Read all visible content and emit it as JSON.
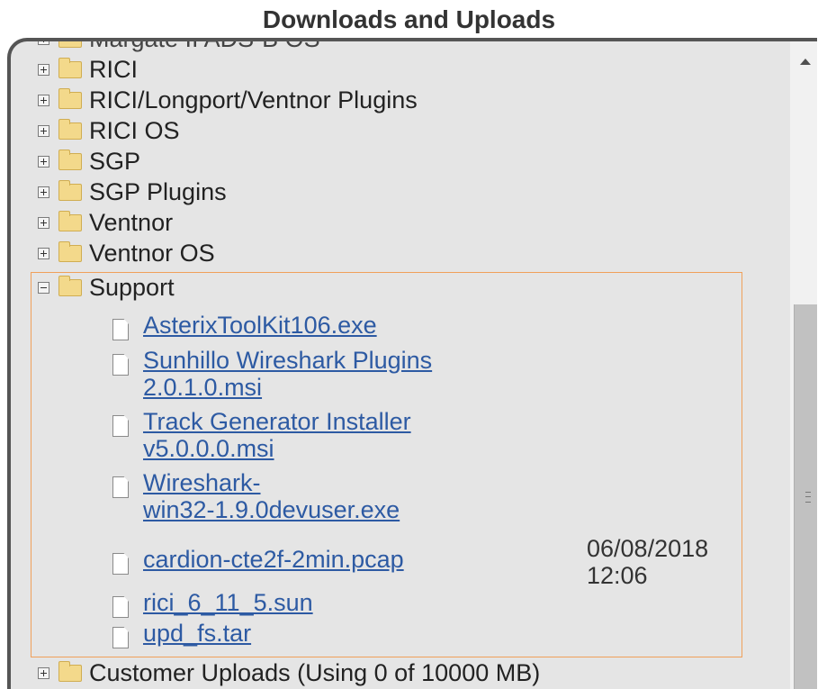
{
  "page_title": "Downloads and Uploads",
  "tree": {
    "partial_top_label": "Margate II ADS-B OS",
    "folders_top": [
      {
        "label": "RICI"
      },
      {
        "label": "RICI/Longport/Ventnor Plugins"
      },
      {
        "label": "RICI OS"
      },
      {
        "label": "SGP"
      },
      {
        "label": "SGP Plugins"
      },
      {
        "label": "Ventnor"
      },
      {
        "label": "Ventnor OS"
      }
    ],
    "support": {
      "label": "Support",
      "files": [
        {
          "line1": "AsterixToolKit106.exe",
          "line2": ""
        },
        {
          "line1": "Sunhillo Wireshark Plugins",
          "line2": "2.0.1.0.msi"
        },
        {
          "line1": "Track Generator Installer",
          "line2": "v5.0.0.0.msi"
        },
        {
          "line1": "Wireshark-",
          "line2": "win32-1.9.0devuser.exe"
        },
        {
          "line1": "cardion-cte2f-2min.pcap",
          "line2": ""
        },
        {
          "line1": "rici_6_11_5.sun",
          "line2": ""
        },
        {
          "line1": "upd_fs.tar",
          "line2": ""
        }
      ],
      "cardion_date": "06/08/2018",
      "cardion_time": "12:06"
    },
    "customer_uploads": "Customer Uploads (Using 0 of 10000 MB)"
  },
  "colors": {
    "link": "#2d5aa3",
    "highlight_border": "#f0a05a",
    "panel_bg": "#e5e5e5",
    "folder": "#f3d98b"
  },
  "icons": [
    "plus-toggle-icon",
    "minus-toggle-icon",
    "folder-icon",
    "file-icon",
    "scroll-up-arrow-icon"
  ]
}
